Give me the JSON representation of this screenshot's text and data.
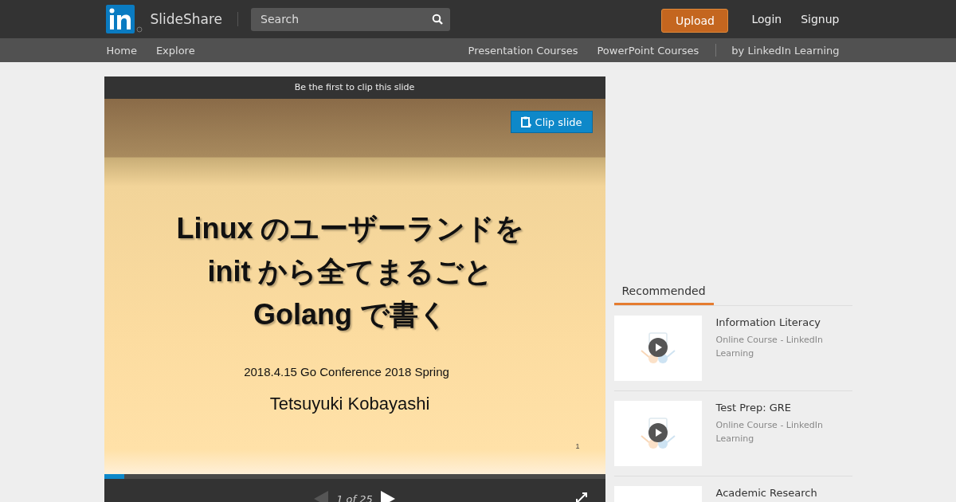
{
  "header": {
    "logo_text": "SlideShare",
    "search": {
      "placeholder": "Search"
    },
    "upload": "Upload",
    "links": [
      "Login",
      "Signup"
    ]
  },
  "subnav": {
    "left": [
      "Home",
      "Explore"
    ],
    "right": [
      "Presentation Courses",
      "PowerPoint Courses"
    ],
    "tail": "by LinkedIn Learning"
  },
  "player": {
    "clip_notice": "Be the first to clip this slide",
    "clip_button": "Clip slide",
    "slide": {
      "title_lines": [
        "Linux のユーザーランドを",
        "init から全てまるごと",
        "Golang で書く"
      ],
      "event": "2018.4.15 Go Conference 2018 Spring",
      "author": "Tetsuyuki Kobayashi",
      "page_number": "1"
    },
    "progress": {
      "level": 0.04
    },
    "pager": "1 of 25",
    "prev_disabled": true
  },
  "sidebar": {
    "tabs": [
      {
        "label": "Recommended",
        "selected": true
      }
    ],
    "items": [
      {
        "title": "Information Literacy",
        "subtitle": "Online Course - LinkedIn Learning"
      },
      {
        "title": "Test Prep: GRE",
        "subtitle": "Online Course - LinkedIn Learning"
      },
      {
        "title": "Academic Research"
      }
    ]
  }
}
